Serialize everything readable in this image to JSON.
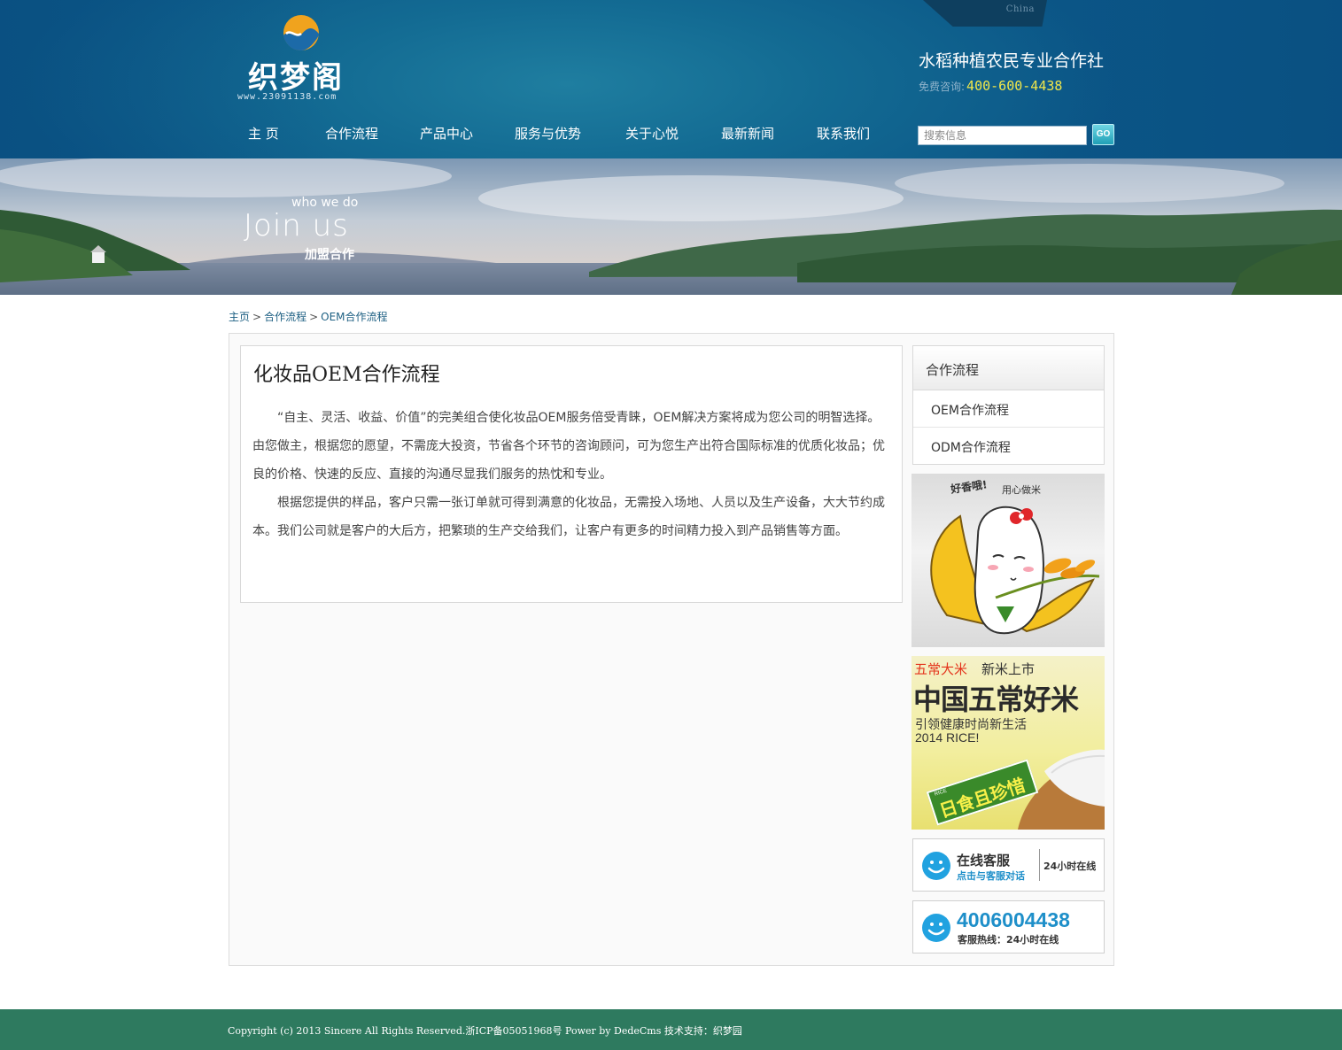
{
  "header": {
    "lang_label": "China",
    "logo_text": "织梦阁",
    "logo_url": "www.23091138.com",
    "coop_name": "水稻种植农民专业合作社",
    "hotline_label": "免费咨询:",
    "hotline_number": "400-600-4438"
  },
  "nav": {
    "items": [
      {
        "label": "主  页"
      },
      {
        "label": "合作流程"
      },
      {
        "label": "产品中心"
      },
      {
        "label": "服务与优势"
      },
      {
        "label": "关于心悦"
      },
      {
        "label": "最新新闻"
      },
      {
        "label": "联系我们"
      }
    ]
  },
  "search": {
    "placeholder": "搜索信息",
    "button_label": "GO"
  },
  "banner": {
    "who": "who we do",
    "join": "Join us",
    "cn": "加盟合作"
  },
  "breadcrumb": {
    "home": "主页",
    "level1": "合作流程",
    "level2": "OEM合作流程",
    "separator": ">"
  },
  "article": {
    "title": "化妆品OEM合作流程",
    "paragraphs": [
      "“自主、灵活、收益、价值”的完美组合使化妆品OEM服务倍受青睐，OEM解决方案将成为您公司的明智选择。由您做主，根据您的愿望，不需庞大投资，节省各个环节的咨询顾问，可为您生产出符合国际标准的优质化妆品；优良的价格、快速的反应、直接的沟通尽显我们服务的热忱和专业。",
      "根据您提供的样品，客户只需一张订单就可得到满意的化妆品，无需投入场地、人员以及生产设备，大大节约成本。我们公司就是客户的大后方，把繁琐的生产交给我们，让客户有更多的时间精力投入到产品销售等方面。"
    ]
  },
  "sidebar": {
    "title": "合作流程",
    "items": [
      {
        "label": "OEM合作流程"
      },
      {
        "label": "ODM合作流程"
      }
    ]
  },
  "promo1": {
    "text1": "好香哦!",
    "text2": "用心做米"
  },
  "promo2": {
    "tag": "五常大米",
    "tag2": "新米上市",
    "headline": "中国五常好米",
    "line1": "引领健康时尚新生活",
    "line2": "2014 RICE!",
    "ribbon_small": "RICE",
    "ribbon": "日食且珍惜"
  },
  "service": {
    "title": "在线客服",
    "subtitle": "点击与客服对话",
    "side": "24小时在线"
  },
  "tel": {
    "number": "4006004438",
    "subtitle": "客服热线：24小时在线"
  },
  "footer": {
    "text": "Copyright (c) 2013 Sincere All Rights Reserved.浙ICP备05051968号 Power by DedeCms  技术支持：织梦园"
  },
  "colors": {
    "header_bg": "#0b5687",
    "footer_bg": "#2e7a5f",
    "link": "#1c5f82",
    "hotline": "#f1e74a",
    "service_blue": "#1e8fc9"
  }
}
